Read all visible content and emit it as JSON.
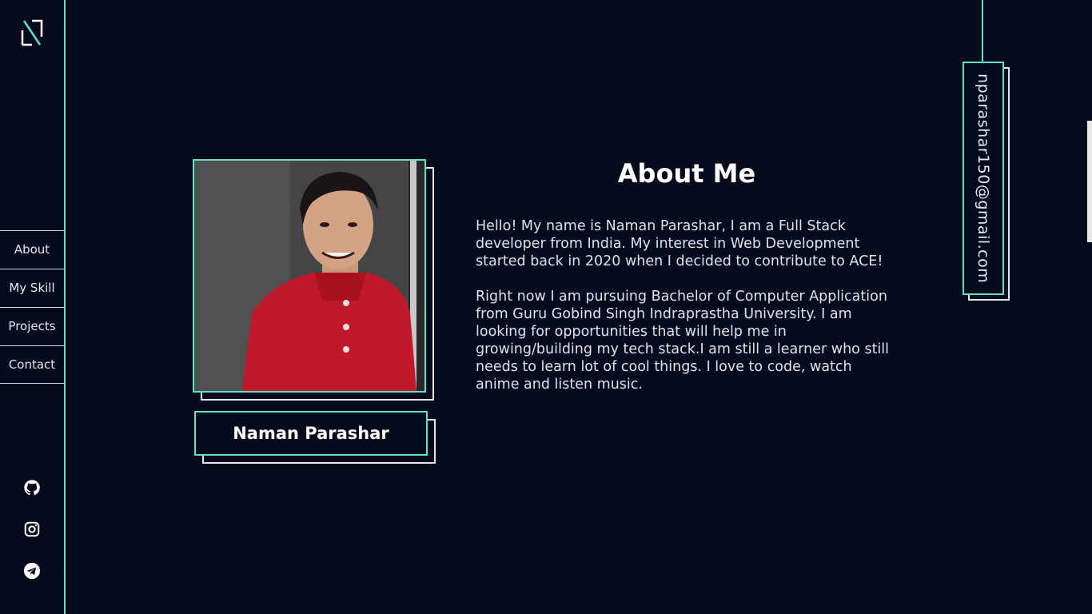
{
  "nav": {
    "items": [
      {
        "label": "About"
      },
      {
        "label": "My Skill"
      },
      {
        "label": "Projects"
      },
      {
        "label": "Contact"
      }
    ]
  },
  "profile": {
    "name": "Naman Parashar"
  },
  "about": {
    "title": "About Me",
    "paragraphs": [
      "Hello! My name is Naman Parashar, I am a Full Stack developer from India. My interest in Web Development started back in 2020 when I decided to contribute to ACE!",
      "Right now I am pursuing Bachelor of Computer Application from Guru Gobind Singh Indraprastha University. I am looking for opportunities that will help me in growing/building my tech stack.I am still a learner who still needs to learn lot of cool things. I love to code, watch anime and listen music."
    ]
  },
  "contact": {
    "email": "nparashar150@gmail.com"
  },
  "social": [
    "github-icon",
    "instagram-icon",
    "telegram-icon"
  ],
  "colors": {
    "background": "#050b1c",
    "accent": "#5ce1c6",
    "text": "#e6e8ee"
  }
}
